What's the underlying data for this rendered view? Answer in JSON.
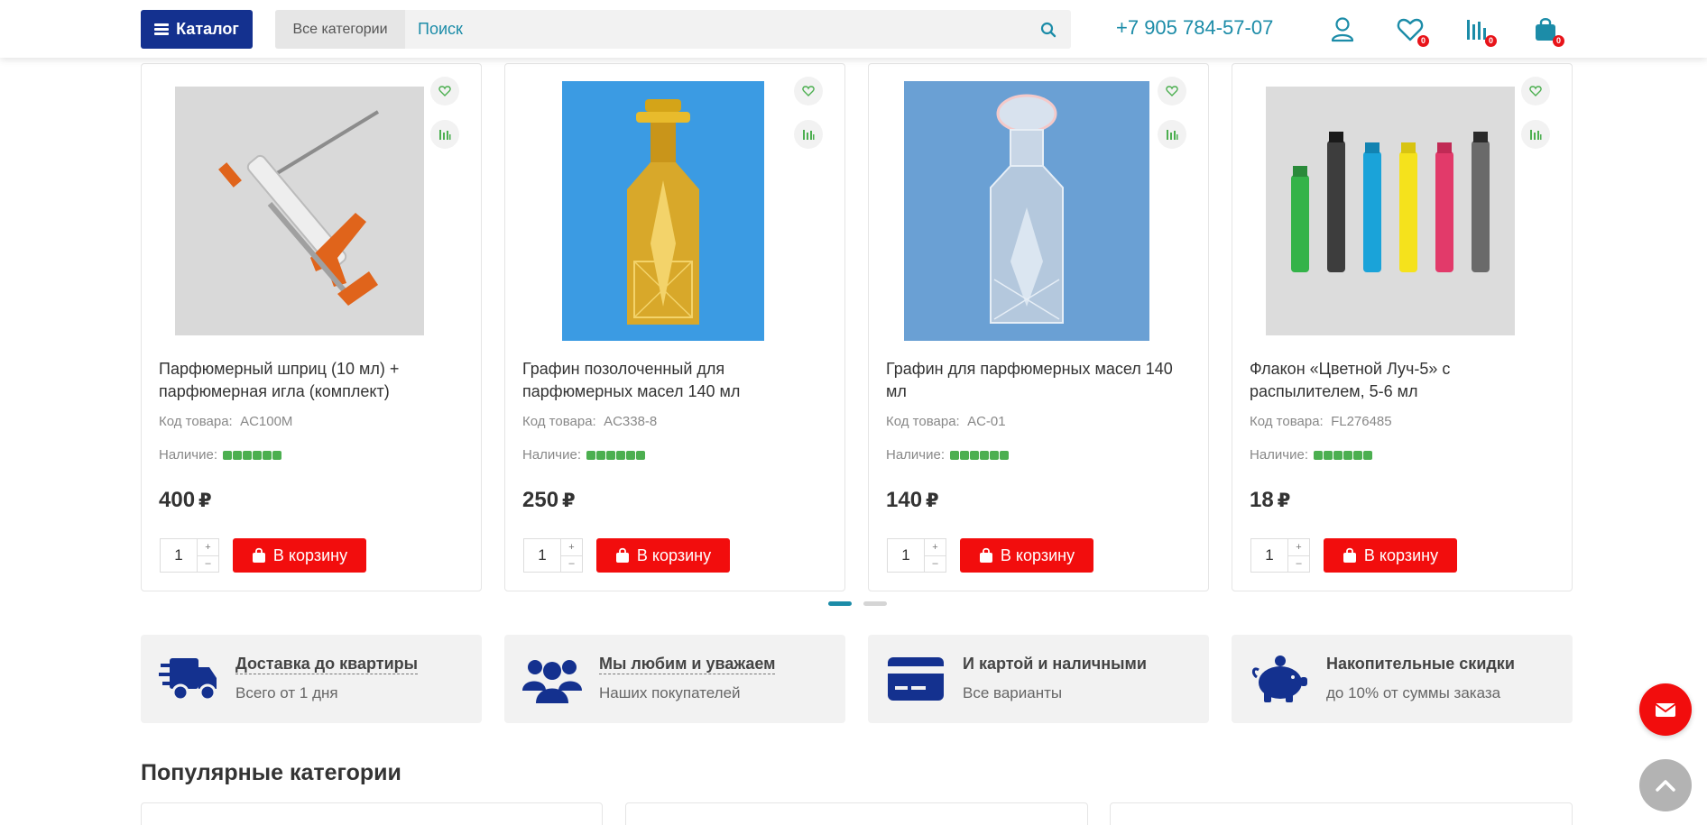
{
  "header": {
    "catalog_label": "Каталог",
    "category_select": "Все категории",
    "search_placeholder": "Поиск",
    "phone": "+7 905 784-57-07",
    "favorites_count": "0",
    "compare_count": "0",
    "cart_count": "0"
  },
  "products": [
    {
      "name": "Парфюмерный шприц (10 мл) + парфюмерная игла (комплект)",
      "code_label": "Код товара:",
      "code": "AC100M",
      "stock_label": "Наличие:",
      "price": "400",
      "currency": "₽",
      "qty": "1",
      "cart_label": "В корзину"
    },
    {
      "name": "Графин позолоченный для парфюмерных масел 140 мл",
      "code_label": "Код товара:",
      "code": "AC338-8",
      "stock_label": "Наличие:",
      "price": "250",
      "currency": "₽",
      "qty": "1",
      "cart_label": "В корзину"
    },
    {
      "name": "Графин для парфюмерных масел 140 мл",
      "code_label": "Код товара:",
      "code": "AC-01",
      "stock_label": "Наличие:",
      "price": "140",
      "currency": "₽",
      "qty": "1",
      "cart_label": "В корзину"
    },
    {
      "name": "Флакон «Цветной Луч-5» с распылителем, 5-6 мл",
      "code_label": "Код товара:",
      "code": "FL276485",
      "stock_label": "Наличие:",
      "price": "18",
      "currency": "₽",
      "qty": "1",
      "cart_label": "В корзину"
    }
  ],
  "features": [
    {
      "title": "Доставка до квартиры",
      "subtitle": "Всего от 1 дня"
    },
    {
      "title": "Мы любим и уважаем",
      "subtitle": "Наших покупателей"
    },
    {
      "title": "И картой и наличными",
      "subtitle": "Все варианты"
    },
    {
      "title": "Накопительные скидки",
      "subtitle": "до 10% от суммы заказа"
    }
  ],
  "popular_title": "Популярные категории",
  "colors": {
    "brand_blue": "#14318f",
    "accent_teal": "#1c8ca8",
    "cart_red": "#f20d0d",
    "stock_green": "#4caf50"
  }
}
